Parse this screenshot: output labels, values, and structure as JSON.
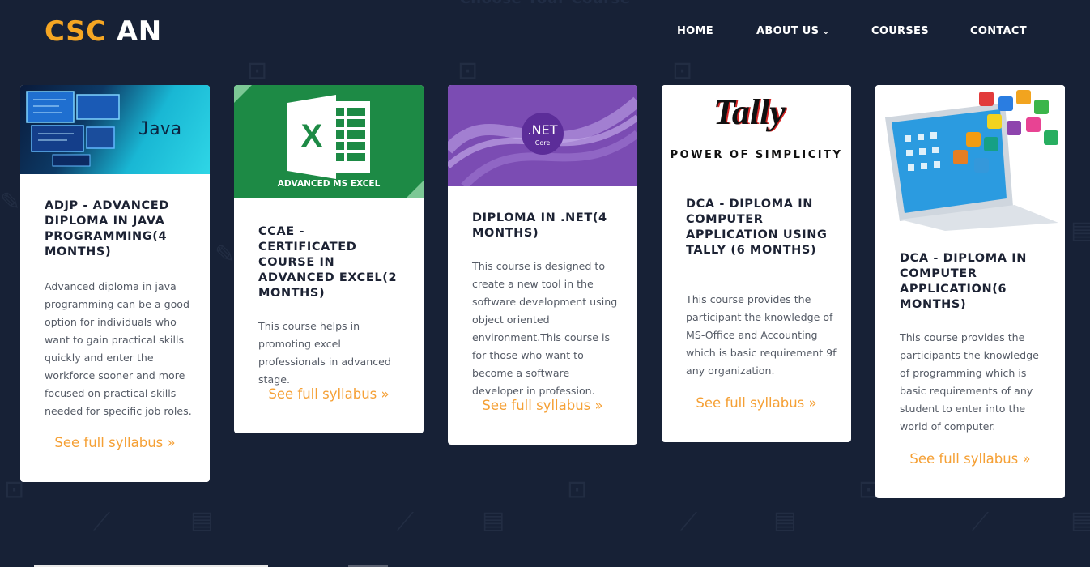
{
  "section_heading": "Choose Your Course",
  "logo": {
    "part1": "CSC",
    "part2": "AN"
  },
  "nav": {
    "home": "HOME",
    "about": "ABOUT US",
    "courses": "COURSES",
    "contact": "CONTACT"
  },
  "cards": [
    {
      "banner_text": "Java",
      "title": "ADJP - ADVANCED DIPLOMA IN JAVA PROGRAMMING(4 MONTHS)",
      "description": "Advanced diploma in java programming can be a good option for individuals who want to gain practical skills quickly and enter the workforce sooner and more focused on practical skills needed for specific job roles.",
      "link": "See full syllabus »"
    },
    {
      "banner_text": "ADVANCED MS EXCEL",
      "title": "CCAE - CERTIFICATED COURSE IN ADVANCED EXCEL(2 MONTHS)",
      "description": "This course helps in promoting excel professionals in advanced stage.",
      "link": "See full syllabus »"
    },
    {
      "banner_text": ".NET",
      "banner_subtext": "Core",
      "title": "DIPLOMA IN .NET(4 MONTHS)",
      "description": "This course is designed to create a new tool in the software development using object oriented environment.This course is for those who want to become a software developer in profession.",
      "link": "See full syllabus »"
    },
    {
      "banner_text": "Tally",
      "banner_subtext": "POWER OF SIMPLICITY",
      "title": "DCA - DIPLOMA IN COMPUTER APPLICATION USING TALLY (6 MONTHS)",
      "description": "This course provides the participant the knowledge of MS-Office and Accounting which is basic requirement 9f any organization.",
      "link": "See full syllabus »"
    },
    {
      "title": "DCA - DIPLOMA IN COMPUTER APPLICATION(6 MONTHS)",
      "description": "This course provides the participants the knowledge of programming which is basic requirements of any student to enter into the world of computer.",
      "link": "See full syllabus »"
    }
  ],
  "colors": {
    "background": "#172136",
    "accent": "#f5a623",
    "link": "#f5a035"
  }
}
